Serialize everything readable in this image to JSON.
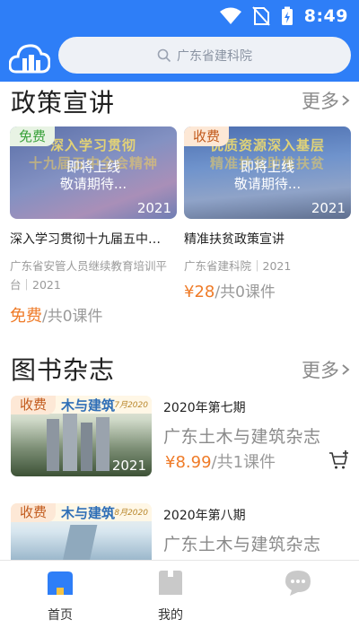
{
  "status_bar": {
    "time": "8:49",
    "icons": [
      "wifi-icon",
      "no-sim-icon",
      "battery-charging-icon"
    ]
  },
  "header": {
    "logo_icon": "cloud-building-logo",
    "search": {
      "placeholder": "广东省建科院",
      "icon": "search-icon"
    }
  },
  "sections": {
    "policy": {
      "title": "政策宣讲",
      "more": "更多",
      "courses": [
        {
          "tag": "免费",
          "tag_type": "free",
          "thumb_headline_1": "深入学习贯彻",
          "thumb_headline_2": "十九届五中全会精神",
          "overlay_line1": "即将上线",
          "overlay_line2": "敬请期待...",
          "year": "2021",
          "title": "深入学习贯彻十九届五中…",
          "source": "广东省安管人员继续教育培训平台｜2021",
          "price": "免费",
          "price_suffix": "/共0课件"
        },
        {
          "tag": "收费",
          "tag_type": "paid",
          "thumb_headline_1": "优质资源深入基层",
          "thumb_headline_2": "精准扶贫助推扶贫",
          "overlay_line1": "即将上线",
          "overlay_line2": "敬请期待...",
          "year": "2021",
          "title": "精准扶贫政策宣讲",
          "source": "广东省建科院｜2021",
          "price": "¥28",
          "price_suffix": "/共0课件"
        }
      ]
    },
    "books": {
      "title": "图书杂志",
      "more": "更多",
      "items": [
        {
          "tag": "收费",
          "cover_title": "木与建筑",
          "cover_issue": "7月2020",
          "year": "2021",
          "issue": "2020年第七期",
          "name": "广东土木与建筑杂志",
          "price": "¥8.99",
          "price_suffix": "/共1课件"
        },
        {
          "tag": "收费",
          "cover_title": "木与建筑",
          "cover_issue": "8月2020",
          "issue": "2020年第八期",
          "name": "广东土木与建筑杂志"
        }
      ]
    }
  },
  "bottom_nav": [
    {
      "label": "首页",
      "icon": "home-icon",
      "active": true
    },
    {
      "label": "我的",
      "icon": "profile-icon",
      "active": false
    },
    {
      "label": "",
      "icon": "chat-icon",
      "active": false
    }
  ],
  "colors": {
    "primary": "#2e7ef7",
    "price": "#ef7b28",
    "free_tag": "#39a13a",
    "paid_tag": "#c25a1c"
  }
}
